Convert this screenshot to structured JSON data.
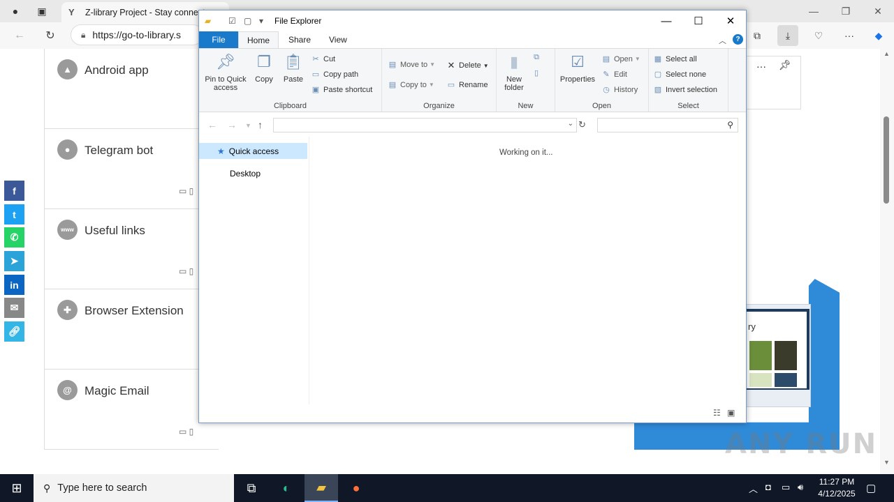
{
  "browser": {
    "tab_title": "Z-library Project - Stay connect",
    "tab_favicon": "Y",
    "url": "https://go-to-library.s",
    "colors": {
      "chrome_bg": "#e9e9e9",
      "toolbar_bg": "#f7f7f7"
    }
  },
  "page": {
    "features": [
      {
        "title": "Android app",
        "icon": "android-icon"
      },
      {
        "title": "Telegram bot",
        "icon": "bot-icon"
      },
      {
        "title": "Useful links",
        "icon": "www-icon"
      },
      {
        "title": "Browser Extension",
        "icon": "puzzle-icon"
      },
      {
        "title": "Magic Email",
        "icon": "at-icon"
      }
    ],
    "social": [
      {
        "name": "facebook",
        "color": "#3b5998"
      },
      {
        "name": "twitter",
        "color": "#1da1f2"
      },
      {
        "name": "whatsapp",
        "color": "#25d366"
      },
      {
        "name": "telegram",
        "color": "#2aa3d8"
      },
      {
        "name": "linkedin",
        "color": "#0a66c2"
      },
      {
        "name": "email",
        "color": "#888888"
      },
      {
        "name": "copy-link",
        "color": "#33b5e5"
      }
    ],
    "mockup_text": "ry",
    "accent": "#2f8ad8"
  },
  "explorer": {
    "title": "File Explorer",
    "tabs": {
      "file": "File",
      "home": "Home",
      "share": "Share",
      "view": "View"
    },
    "clipboard": {
      "pin": "Pin to Quick access",
      "copy": "Copy",
      "paste": "Paste",
      "cut": "Cut",
      "copy_path": "Copy path",
      "paste_shortcut": "Paste shortcut",
      "label": "Clipboard"
    },
    "organize": {
      "move_to": "Move to",
      "copy_to": "Copy to",
      "delete": "Delete",
      "rename": "Rename",
      "label": "Organize"
    },
    "new": {
      "new_folder": "New folder",
      "label": "New"
    },
    "open": {
      "properties": "Properties",
      "open": "Open",
      "edit": "Edit",
      "history": "History",
      "label": "Open"
    },
    "select": {
      "select_all": "Select all",
      "select_none": "Select none",
      "invert": "Invert selection",
      "label": "Select"
    },
    "nav_pane": {
      "quick_access": "Quick access",
      "desktop": "Desktop"
    },
    "status": "Working on it...",
    "accent": "#1979ca"
  },
  "taskbar": {
    "search_placeholder": "Type here to search",
    "time": "11:27 PM",
    "date": "4/12/2025"
  },
  "watermark": "ANY RUN"
}
